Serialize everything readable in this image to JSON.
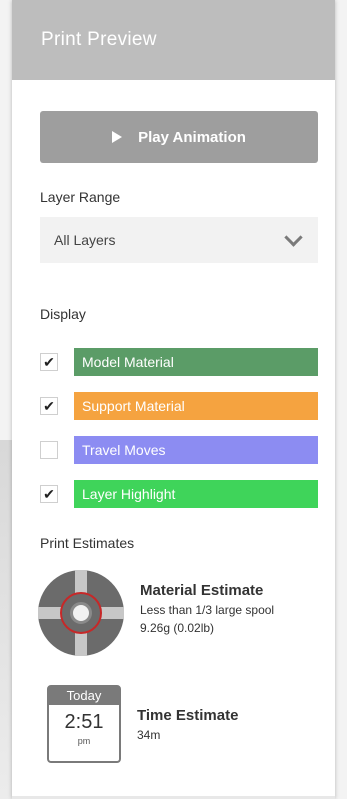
{
  "panel": {
    "title": "Print Preview",
    "play_button_label": "Play Animation"
  },
  "layer_range": {
    "label": "Layer Range",
    "selected": "All Layers"
  },
  "display": {
    "label": "Display",
    "items": [
      {
        "label": "Model Material",
        "checked": true,
        "checkmark": "✔",
        "color": "#5b9c67"
      },
      {
        "label": "Support Material",
        "checked": true,
        "checkmark": "✔",
        "color": "#f5a340"
      },
      {
        "label": "Travel Moves",
        "checked": false,
        "checkmark": "",
        "color": "#8c8cf2"
      },
      {
        "label": "Layer Highlight",
        "checked": true,
        "checkmark": "✔",
        "color": "#3fd45a"
      }
    ]
  },
  "estimates": {
    "label": "Print Estimates",
    "material": {
      "title": "Material Estimate",
      "line1": "Less than 1/3 large spool",
      "line2": "9.26g (0.02lb)"
    },
    "time": {
      "title": "Time Estimate",
      "value": "34m",
      "calendar_day": "Today",
      "calendar_time": "2:51",
      "calendar_ampm": "pm"
    }
  },
  "colors": {
    "header_bg": "#bdbdbd",
    "button_bg": "#9e9e9e",
    "spool_ring": "#c62828"
  }
}
